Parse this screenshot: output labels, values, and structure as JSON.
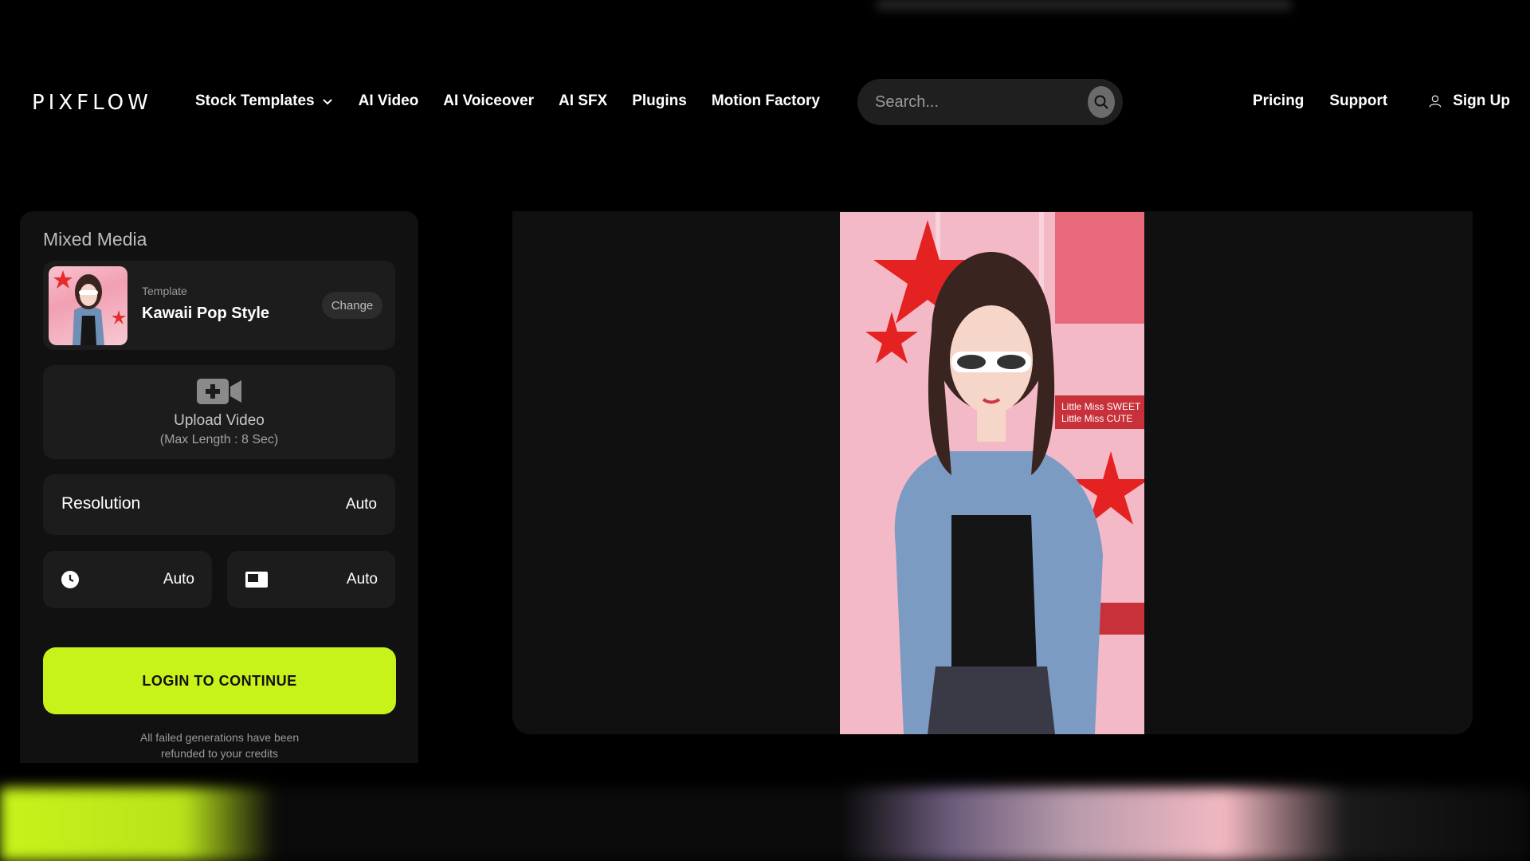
{
  "header": {
    "logo": "PIXFLOW",
    "nav": [
      {
        "label": "Stock Templates",
        "has_dropdown": true
      },
      {
        "label": "AI Video"
      },
      {
        "label": "AI Voiceover"
      },
      {
        "label": "AI SFX"
      },
      {
        "label": "Plugins"
      },
      {
        "label": "Motion Factory"
      }
    ],
    "search_placeholder": "Search...",
    "pricing": "Pricing",
    "support": "Support",
    "signup": "Sign Up"
  },
  "panel": {
    "title": "Mixed Media",
    "template": {
      "label": "Template",
      "name": "Kawaii Pop Style",
      "change": "Change"
    },
    "upload": {
      "label": "Upload Video",
      "sub": "(Max Length : 8 Sec)"
    },
    "resolution": {
      "label": "Resolution",
      "value": "Auto"
    },
    "duration_value": "Auto",
    "aspect_value": "Auto",
    "login_button": "LOGIN TO CONTINUE",
    "refund_note_1": "All failed generations have been",
    "refund_note_2": "refunded to your credits"
  },
  "preview": {
    "art_text_1": "Little Miss SWEET",
    "art_text_2": "Little Miss CUTE"
  },
  "colors": {
    "accent": "#c8f31a",
    "panel_bg": "#111111",
    "card_bg": "#1c1c1c"
  }
}
